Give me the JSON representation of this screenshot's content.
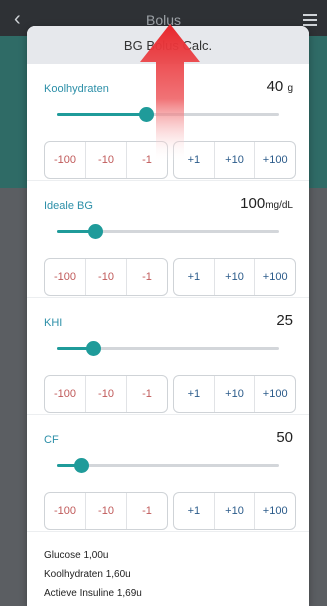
{
  "appbar": {
    "back_icon": "chevron-left-icon",
    "title": "Bolus",
    "menu_icon": "hamburger-menu-icon"
  },
  "sheet": {
    "title": "BG Bolus Calc."
  },
  "sections": [
    {
      "label": "Koolhydraten",
      "value": "40",
      "unit": "g",
      "slider_fraction": 0.4
    },
    {
      "label": "Ideale BG",
      "value": "100",
      "unit": "mg/dL",
      "slider_fraction": 0.17
    },
    {
      "label": "KHI",
      "value": "25",
      "unit": "",
      "slider_fraction": 0.16
    },
    {
      "label": "CF",
      "value": "50",
      "unit": "",
      "slider_fraction": 0.11
    }
  ],
  "steps": {
    "neg": [
      "-100",
      "-10",
      "-1"
    ],
    "pos": [
      "+1",
      "+10",
      "+100"
    ]
  },
  "summary": {
    "glucose": "Glucose  1,00u",
    "carbs": "Koolhydraten  1,60u",
    "active": "Actieve Insuline  1,69u"
  },
  "colors": {
    "accent": "#1f9b9a",
    "label": "#2c8fa8",
    "negative": "#c05a5a",
    "positive": "#2b5b8a",
    "arrow": "#e8262b"
  }
}
